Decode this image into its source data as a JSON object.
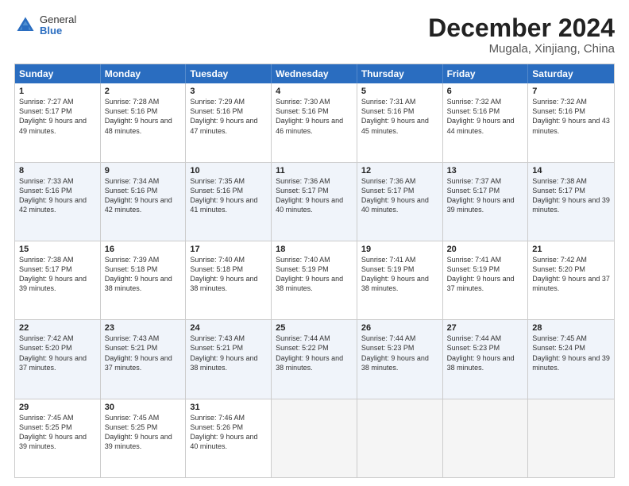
{
  "logo": {
    "general": "General",
    "blue": "Blue"
  },
  "title": "December 2024",
  "location": "Mugala, Xinjiang, China",
  "days_of_week": [
    "Sunday",
    "Monday",
    "Tuesday",
    "Wednesday",
    "Thursday",
    "Friday",
    "Saturday"
  ],
  "weeks": [
    [
      {
        "day": "1",
        "sunrise": "Sunrise: 7:27 AM",
        "sunset": "Sunset: 5:17 PM",
        "daylight": "Daylight: 9 hours and 49 minutes."
      },
      {
        "day": "2",
        "sunrise": "Sunrise: 7:28 AM",
        "sunset": "Sunset: 5:16 PM",
        "daylight": "Daylight: 9 hours and 48 minutes."
      },
      {
        "day": "3",
        "sunrise": "Sunrise: 7:29 AM",
        "sunset": "Sunset: 5:16 PM",
        "daylight": "Daylight: 9 hours and 47 minutes."
      },
      {
        "day": "4",
        "sunrise": "Sunrise: 7:30 AM",
        "sunset": "Sunset: 5:16 PM",
        "daylight": "Daylight: 9 hours and 46 minutes."
      },
      {
        "day": "5",
        "sunrise": "Sunrise: 7:31 AM",
        "sunset": "Sunset: 5:16 PM",
        "daylight": "Daylight: 9 hours and 45 minutes."
      },
      {
        "day": "6",
        "sunrise": "Sunrise: 7:32 AM",
        "sunset": "Sunset: 5:16 PM",
        "daylight": "Daylight: 9 hours and 44 minutes."
      },
      {
        "day": "7",
        "sunrise": "Sunrise: 7:32 AM",
        "sunset": "Sunset: 5:16 PM",
        "daylight": "Daylight: 9 hours and 43 minutes."
      }
    ],
    [
      {
        "day": "8",
        "sunrise": "Sunrise: 7:33 AM",
        "sunset": "Sunset: 5:16 PM",
        "daylight": "Daylight: 9 hours and 42 minutes."
      },
      {
        "day": "9",
        "sunrise": "Sunrise: 7:34 AM",
        "sunset": "Sunset: 5:16 PM",
        "daylight": "Daylight: 9 hours and 42 minutes."
      },
      {
        "day": "10",
        "sunrise": "Sunrise: 7:35 AM",
        "sunset": "Sunset: 5:16 PM",
        "daylight": "Daylight: 9 hours and 41 minutes."
      },
      {
        "day": "11",
        "sunrise": "Sunrise: 7:36 AM",
        "sunset": "Sunset: 5:17 PM",
        "daylight": "Daylight: 9 hours and 40 minutes."
      },
      {
        "day": "12",
        "sunrise": "Sunrise: 7:36 AM",
        "sunset": "Sunset: 5:17 PM",
        "daylight": "Daylight: 9 hours and 40 minutes."
      },
      {
        "day": "13",
        "sunrise": "Sunrise: 7:37 AM",
        "sunset": "Sunset: 5:17 PM",
        "daylight": "Daylight: 9 hours and 39 minutes."
      },
      {
        "day": "14",
        "sunrise": "Sunrise: 7:38 AM",
        "sunset": "Sunset: 5:17 PM",
        "daylight": "Daylight: 9 hours and 39 minutes."
      }
    ],
    [
      {
        "day": "15",
        "sunrise": "Sunrise: 7:38 AM",
        "sunset": "Sunset: 5:17 PM",
        "daylight": "Daylight: 9 hours and 39 minutes."
      },
      {
        "day": "16",
        "sunrise": "Sunrise: 7:39 AM",
        "sunset": "Sunset: 5:18 PM",
        "daylight": "Daylight: 9 hours and 38 minutes."
      },
      {
        "day": "17",
        "sunrise": "Sunrise: 7:40 AM",
        "sunset": "Sunset: 5:18 PM",
        "daylight": "Daylight: 9 hours and 38 minutes."
      },
      {
        "day": "18",
        "sunrise": "Sunrise: 7:40 AM",
        "sunset": "Sunset: 5:19 PM",
        "daylight": "Daylight: 9 hours and 38 minutes."
      },
      {
        "day": "19",
        "sunrise": "Sunrise: 7:41 AM",
        "sunset": "Sunset: 5:19 PM",
        "daylight": "Daylight: 9 hours and 38 minutes."
      },
      {
        "day": "20",
        "sunrise": "Sunrise: 7:41 AM",
        "sunset": "Sunset: 5:19 PM",
        "daylight": "Daylight: 9 hours and 37 minutes."
      },
      {
        "day": "21",
        "sunrise": "Sunrise: 7:42 AM",
        "sunset": "Sunset: 5:20 PM",
        "daylight": "Daylight: 9 hours and 37 minutes."
      }
    ],
    [
      {
        "day": "22",
        "sunrise": "Sunrise: 7:42 AM",
        "sunset": "Sunset: 5:20 PM",
        "daylight": "Daylight: 9 hours and 37 minutes."
      },
      {
        "day": "23",
        "sunrise": "Sunrise: 7:43 AM",
        "sunset": "Sunset: 5:21 PM",
        "daylight": "Daylight: 9 hours and 37 minutes."
      },
      {
        "day": "24",
        "sunrise": "Sunrise: 7:43 AM",
        "sunset": "Sunset: 5:21 PM",
        "daylight": "Daylight: 9 hours and 38 minutes."
      },
      {
        "day": "25",
        "sunrise": "Sunrise: 7:44 AM",
        "sunset": "Sunset: 5:22 PM",
        "daylight": "Daylight: 9 hours and 38 minutes."
      },
      {
        "day": "26",
        "sunrise": "Sunrise: 7:44 AM",
        "sunset": "Sunset: 5:23 PM",
        "daylight": "Daylight: 9 hours and 38 minutes."
      },
      {
        "day": "27",
        "sunrise": "Sunrise: 7:44 AM",
        "sunset": "Sunset: 5:23 PM",
        "daylight": "Daylight: 9 hours and 38 minutes."
      },
      {
        "day": "28",
        "sunrise": "Sunrise: 7:45 AM",
        "sunset": "Sunset: 5:24 PM",
        "daylight": "Daylight: 9 hours and 39 minutes."
      }
    ],
    [
      {
        "day": "29",
        "sunrise": "Sunrise: 7:45 AM",
        "sunset": "Sunset: 5:25 PM",
        "daylight": "Daylight: 9 hours and 39 minutes."
      },
      {
        "day": "30",
        "sunrise": "Sunrise: 7:45 AM",
        "sunset": "Sunset: 5:25 PM",
        "daylight": "Daylight: 9 hours and 39 minutes."
      },
      {
        "day": "31",
        "sunrise": "Sunrise: 7:46 AM",
        "sunset": "Sunset: 5:26 PM",
        "daylight": "Daylight: 9 hours and 40 minutes."
      },
      {
        "day": "",
        "sunrise": "",
        "sunset": "",
        "daylight": ""
      },
      {
        "day": "",
        "sunrise": "",
        "sunset": "",
        "daylight": ""
      },
      {
        "day": "",
        "sunrise": "",
        "sunset": "",
        "daylight": ""
      },
      {
        "day": "",
        "sunrise": "",
        "sunset": "",
        "daylight": ""
      }
    ]
  ]
}
